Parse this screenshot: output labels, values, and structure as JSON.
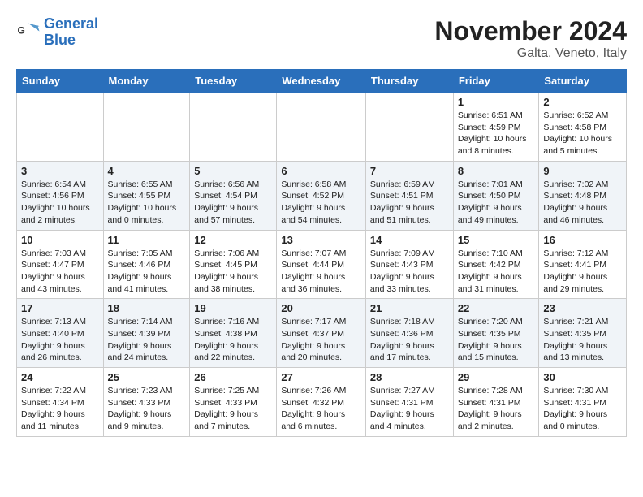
{
  "header": {
    "logo_line1": "General",
    "logo_line2": "Blue",
    "month": "November 2024",
    "location": "Galta, Veneto, Italy"
  },
  "days_of_week": [
    "Sunday",
    "Monday",
    "Tuesday",
    "Wednesday",
    "Thursday",
    "Friday",
    "Saturday"
  ],
  "weeks": [
    [
      {
        "day": "",
        "info": ""
      },
      {
        "day": "",
        "info": ""
      },
      {
        "day": "",
        "info": ""
      },
      {
        "day": "",
        "info": ""
      },
      {
        "day": "",
        "info": ""
      },
      {
        "day": "1",
        "info": "Sunrise: 6:51 AM\nSunset: 4:59 PM\nDaylight: 10 hours and 8 minutes."
      },
      {
        "day": "2",
        "info": "Sunrise: 6:52 AM\nSunset: 4:58 PM\nDaylight: 10 hours and 5 minutes."
      }
    ],
    [
      {
        "day": "3",
        "info": "Sunrise: 6:54 AM\nSunset: 4:56 PM\nDaylight: 10 hours and 2 minutes."
      },
      {
        "day": "4",
        "info": "Sunrise: 6:55 AM\nSunset: 4:55 PM\nDaylight: 10 hours and 0 minutes."
      },
      {
        "day": "5",
        "info": "Sunrise: 6:56 AM\nSunset: 4:54 PM\nDaylight: 9 hours and 57 minutes."
      },
      {
        "day": "6",
        "info": "Sunrise: 6:58 AM\nSunset: 4:52 PM\nDaylight: 9 hours and 54 minutes."
      },
      {
        "day": "7",
        "info": "Sunrise: 6:59 AM\nSunset: 4:51 PM\nDaylight: 9 hours and 51 minutes."
      },
      {
        "day": "8",
        "info": "Sunrise: 7:01 AM\nSunset: 4:50 PM\nDaylight: 9 hours and 49 minutes."
      },
      {
        "day": "9",
        "info": "Sunrise: 7:02 AM\nSunset: 4:48 PM\nDaylight: 9 hours and 46 minutes."
      }
    ],
    [
      {
        "day": "10",
        "info": "Sunrise: 7:03 AM\nSunset: 4:47 PM\nDaylight: 9 hours and 43 minutes."
      },
      {
        "day": "11",
        "info": "Sunrise: 7:05 AM\nSunset: 4:46 PM\nDaylight: 9 hours and 41 minutes."
      },
      {
        "day": "12",
        "info": "Sunrise: 7:06 AM\nSunset: 4:45 PM\nDaylight: 9 hours and 38 minutes."
      },
      {
        "day": "13",
        "info": "Sunrise: 7:07 AM\nSunset: 4:44 PM\nDaylight: 9 hours and 36 minutes."
      },
      {
        "day": "14",
        "info": "Sunrise: 7:09 AM\nSunset: 4:43 PM\nDaylight: 9 hours and 33 minutes."
      },
      {
        "day": "15",
        "info": "Sunrise: 7:10 AM\nSunset: 4:42 PM\nDaylight: 9 hours and 31 minutes."
      },
      {
        "day": "16",
        "info": "Sunrise: 7:12 AM\nSunset: 4:41 PM\nDaylight: 9 hours and 29 minutes."
      }
    ],
    [
      {
        "day": "17",
        "info": "Sunrise: 7:13 AM\nSunset: 4:40 PM\nDaylight: 9 hours and 26 minutes."
      },
      {
        "day": "18",
        "info": "Sunrise: 7:14 AM\nSunset: 4:39 PM\nDaylight: 9 hours and 24 minutes."
      },
      {
        "day": "19",
        "info": "Sunrise: 7:16 AM\nSunset: 4:38 PM\nDaylight: 9 hours and 22 minutes."
      },
      {
        "day": "20",
        "info": "Sunrise: 7:17 AM\nSunset: 4:37 PM\nDaylight: 9 hours and 20 minutes."
      },
      {
        "day": "21",
        "info": "Sunrise: 7:18 AM\nSunset: 4:36 PM\nDaylight: 9 hours and 17 minutes."
      },
      {
        "day": "22",
        "info": "Sunrise: 7:20 AM\nSunset: 4:35 PM\nDaylight: 9 hours and 15 minutes."
      },
      {
        "day": "23",
        "info": "Sunrise: 7:21 AM\nSunset: 4:35 PM\nDaylight: 9 hours and 13 minutes."
      }
    ],
    [
      {
        "day": "24",
        "info": "Sunrise: 7:22 AM\nSunset: 4:34 PM\nDaylight: 9 hours and 11 minutes."
      },
      {
        "day": "25",
        "info": "Sunrise: 7:23 AM\nSunset: 4:33 PM\nDaylight: 9 hours and 9 minutes."
      },
      {
        "day": "26",
        "info": "Sunrise: 7:25 AM\nSunset: 4:33 PM\nDaylight: 9 hours and 7 minutes."
      },
      {
        "day": "27",
        "info": "Sunrise: 7:26 AM\nSunset: 4:32 PM\nDaylight: 9 hours and 6 minutes."
      },
      {
        "day": "28",
        "info": "Sunrise: 7:27 AM\nSunset: 4:31 PM\nDaylight: 9 hours and 4 minutes."
      },
      {
        "day": "29",
        "info": "Sunrise: 7:28 AM\nSunset: 4:31 PM\nDaylight: 9 hours and 2 minutes."
      },
      {
        "day": "30",
        "info": "Sunrise: 7:30 AM\nSunset: 4:31 PM\nDaylight: 9 hours and 0 minutes."
      }
    ]
  ]
}
